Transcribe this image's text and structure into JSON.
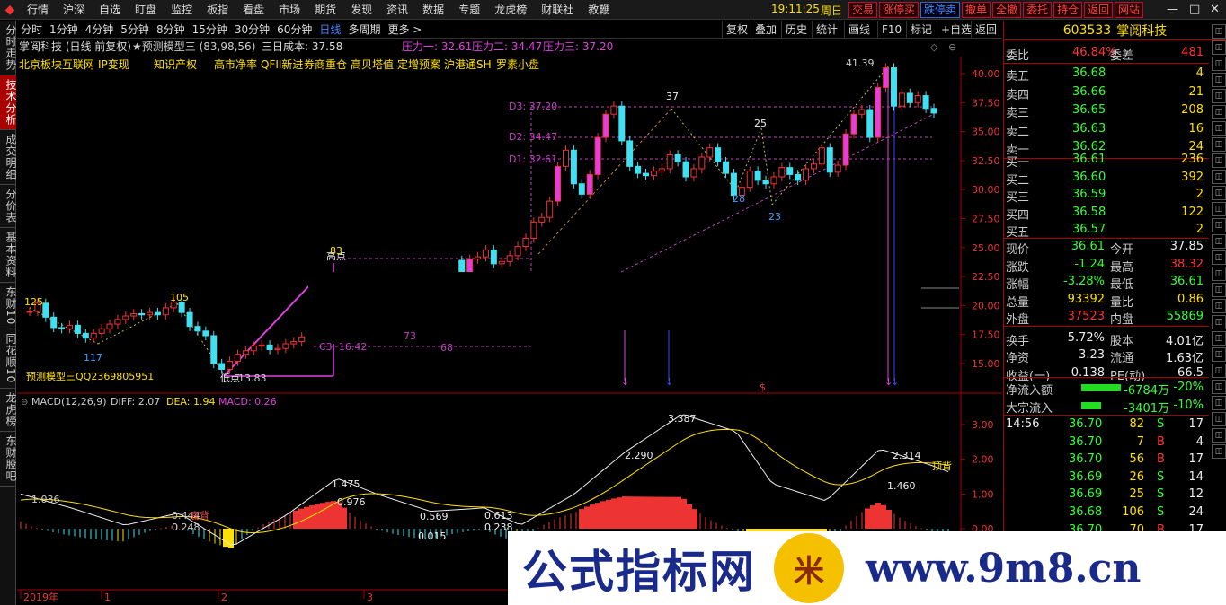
{
  "menubar": {
    "items": [
      "行情",
      "沪深",
      "自选",
      "盯盘",
      "监控",
      "板指",
      "看盘",
      "市场",
      "期货",
      "发现",
      "资讯",
      "数据",
      "专题",
      "龙虎榜",
      "财联社",
      "教鞭"
    ],
    "clock": "19:11:25",
    "weekday": "周日",
    "quick_buttons": [
      "交易",
      "涨停买",
      "跌停卖",
      "撤单",
      "全撤",
      "委托",
      "持仓",
      "返回",
      "网站"
    ],
    "win_controls": [
      "—",
      "□",
      "✕"
    ]
  },
  "leftbar": {
    "tabs": [
      "分时走势",
      "技术分析",
      "成交明细",
      "分价表",
      "基本资料",
      "东财10",
      "同花顺10",
      "龙虎榜",
      "东财股吧"
    ],
    "active": 1
  },
  "periodbar": {
    "items": [
      "分时",
      "1分钟",
      "4分钟",
      "5分钟",
      "8分钟",
      "15分钟",
      "30分钟",
      "60分钟",
      "日线",
      "多周期",
      "更多 >"
    ],
    "active": "日线"
  },
  "toolbar": {
    "buttons": [
      "复权",
      "叠加",
      "历史",
      "统计",
      "画线",
      "F10",
      "标记",
      "+自选",
      "返回"
    ]
  },
  "chart_header": {
    "title": "掌阅科技 (日线 前复权)",
    "indicator": "★预测模型三 (83,98,56)",
    "cost": "三日成本: 37.58",
    "p1": "压力一: 32.61",
    "p2": "压力二: 34.47",
    "p3": "压力三: 37.20"
  },
  "concepts": {
    "left": [
      "北京板块",
      "互联网",
      "IP变现",
      "知识产权"
    ],
    "right": [
      "高市净率",
      "QFII新进",
      "券商重仓",
      "高贝塔值",
      "定增预案",
      "沪港通SH",
      "罗素小盘"
    ]
  },
  "price_axis": [
    "40.00",
    "37.50",
    "35.00",
    "32.50",
    "30.00",
    "27.50",
    "25.00",
    "22.50",
    "20.00",
    "17.50",
    "15.00"
  ],
  "macd_axis": [
    "3.00",
    "2.00",
    "1.00",
    "0.00"
  ],
  "time_axis": [
    "2019年",
    "1",
    "2",
    "3"
  ],
  "annotations": {
    "d3": "D3: 37.20",
    "d2": "D2: 34.47",
    "d1": "D1: 32.61",
    "c3": "C3: 16.42",
    "high_pt": "高点",
    "low_pt": "低点",
    "n83": "83",
    "n1383": "13.83",
    "n125": "125",
    "n105": "105",
    "n117": "117",
    "n73": "73",
    "n68": "68",
    "n37": "37",
    "n25": "25",
    "n28": "28",
    "n23": "23",
    "max": "41.39",
    "model": "预测模型三QQ2369805951"
  },
  "macd_header": {
    "name": "MACD(12,26,9)",
    "diff": "DIFF: 2.07",
    "dea": "DEA: 1.94",
    "macd": "MACD: 0.26"
  },
  "macd_labels": {
    "a": "1.036",
    "b": "0.444",
    "c": "0.248",
    "d": "底背",
    "e": "1.475",
    "f": "0.976",
    "g": "0.569",
    "h": "0.015",
    "i": "0.613",
    "j": "0.238",
    "k": "2.290",
    "l": "3.387",
    "m": "2.314",
    "n": "1.460",
    "o": "顶背"
  },
  "quote": {
    "code": "603533",
    "name": "掌阅科技",
    "weibi_label": "委比",
    "weibi": "46.84%",
    "weicha_label": "委差",
    "weicha": "481",
    "asks": [
      {
        "label": "卖五",
        "price": "36.68",
        "vol": "4"
      },
      {
        "label": "卖四",
        "price": "36.66",
        "vol": "21"
      },
      {
        "label": "卖三",
        "price": "36.65",
        "vol": "208"
      },
      {
        "label": "卖二",
        "price": "36.63",
        "vol": "16"
      },
      {
        "label": "卖一",
        "price": "36.62",
        "vol": "24"
      }
    ],
    "bids": [
      {
        "label": "买一",
        "price": "36.61",
        "vol": "236"
      },
      {
        "label": "买二",
        "price": "36.60",
        "vol": "392"
      },
      {
        "label": "买三",
        "price": "36.59",
        "vol": "2"
      },
      {
        "label": "买四",
        "price": "36.58",
        "vol": "122"
      },
      {
        "label": "买五",
        "price": "36.57",
        "vol": "2"
      }
    ],
    "stats": [
      {
        "l1": "现价",
        "v1": "36.61",
        "c1": "green",
        "l2": "今开",
        "v2": "37.85",
        "c2": "white"
      },
      {
        "l1": "涨跌",
        "v1": "-1.24",
        "c1": "green",
        "l2": "最高",
        "v2": "38.32",
        "c2": "red"
      },
      {
        "l1": "涨幅",
        "v1": "-3.28%",
        "c1": "green",
        "l2": "最低",
        "v2": "36.61",
        "c2": "green"
      },
      {
        "l1": "总量",
        "v1": "93392",
        "c1": "yellow",
        "l2": "量比",
        "v2": "0.86",
        "c2": "yellow"
      },
      {
        "l1": "外盘",
        "v1": "37523",
        "c1": "red",
        "l2": "内盘",
        "v2": "55869",
        "c2": "green"
      },
      {
        "l1": "换手",
        "v1": "5.72%",
        "c1": "white",
        "l2": "股本",
        "v2": "4.01亿",
        "c2": "white"
      },
      {
        "l1": "净资",
        "v1": "3.23",
        "c1": "white",
        "l2": "流通",
        "v2": "1.63亿",
        "c2": "white"
      },
      {
        "l1": "收益(一)",
        "v1": "0.138",
        "c1": "white",
        "l2": "PE(动)",
        "v2": "66.5",
        "c2": "white"
      }
    ],
    "flows": [
      {
        "label": "净流入额",
        "value": "-6784万",
        "pct": "-20%"
      },
      {
        "label": "大宗流入",
        "value": "-3401万",
        "pct": "-10%"
      }
    ],
    "ticks": [
      {
        "time": "14:56",
        "price": "36.70",
        "vol": "82",
        "side": "S",
        "n": "17"
      },
      {
        "time": "",
        "price": "36.70",
        "vol": "7",
        "side": "B",
        "n": "4"
      },
      {
        "time": "",
        "price": "36.70",
        "vol": "56",
        "side": "B",
        "n": "17"
      },
      {
        "time": "",
        "price": "36.69",
        "vol": "26",
        "side": "S",
        "n": "14"
      },
      {
        "time": "",
        "price": "36.69",
        "vol": "25",
        "side": "S",
        "n": "12"
      },
      {
        "time": "",
        "price": "36.68",
        "vol": "106",
        "side": "S",
        "n": "24"
      },
      {
        "time": "",
        "price": "36.70",
        "vol": "70",
        "side": "B",
        "n": "17"
      }
    ]
  },
  "watermark": {
    "cn": "公式指标网",
    "seal": "米",
    "url": "www.9m8.cn"
  }
}
